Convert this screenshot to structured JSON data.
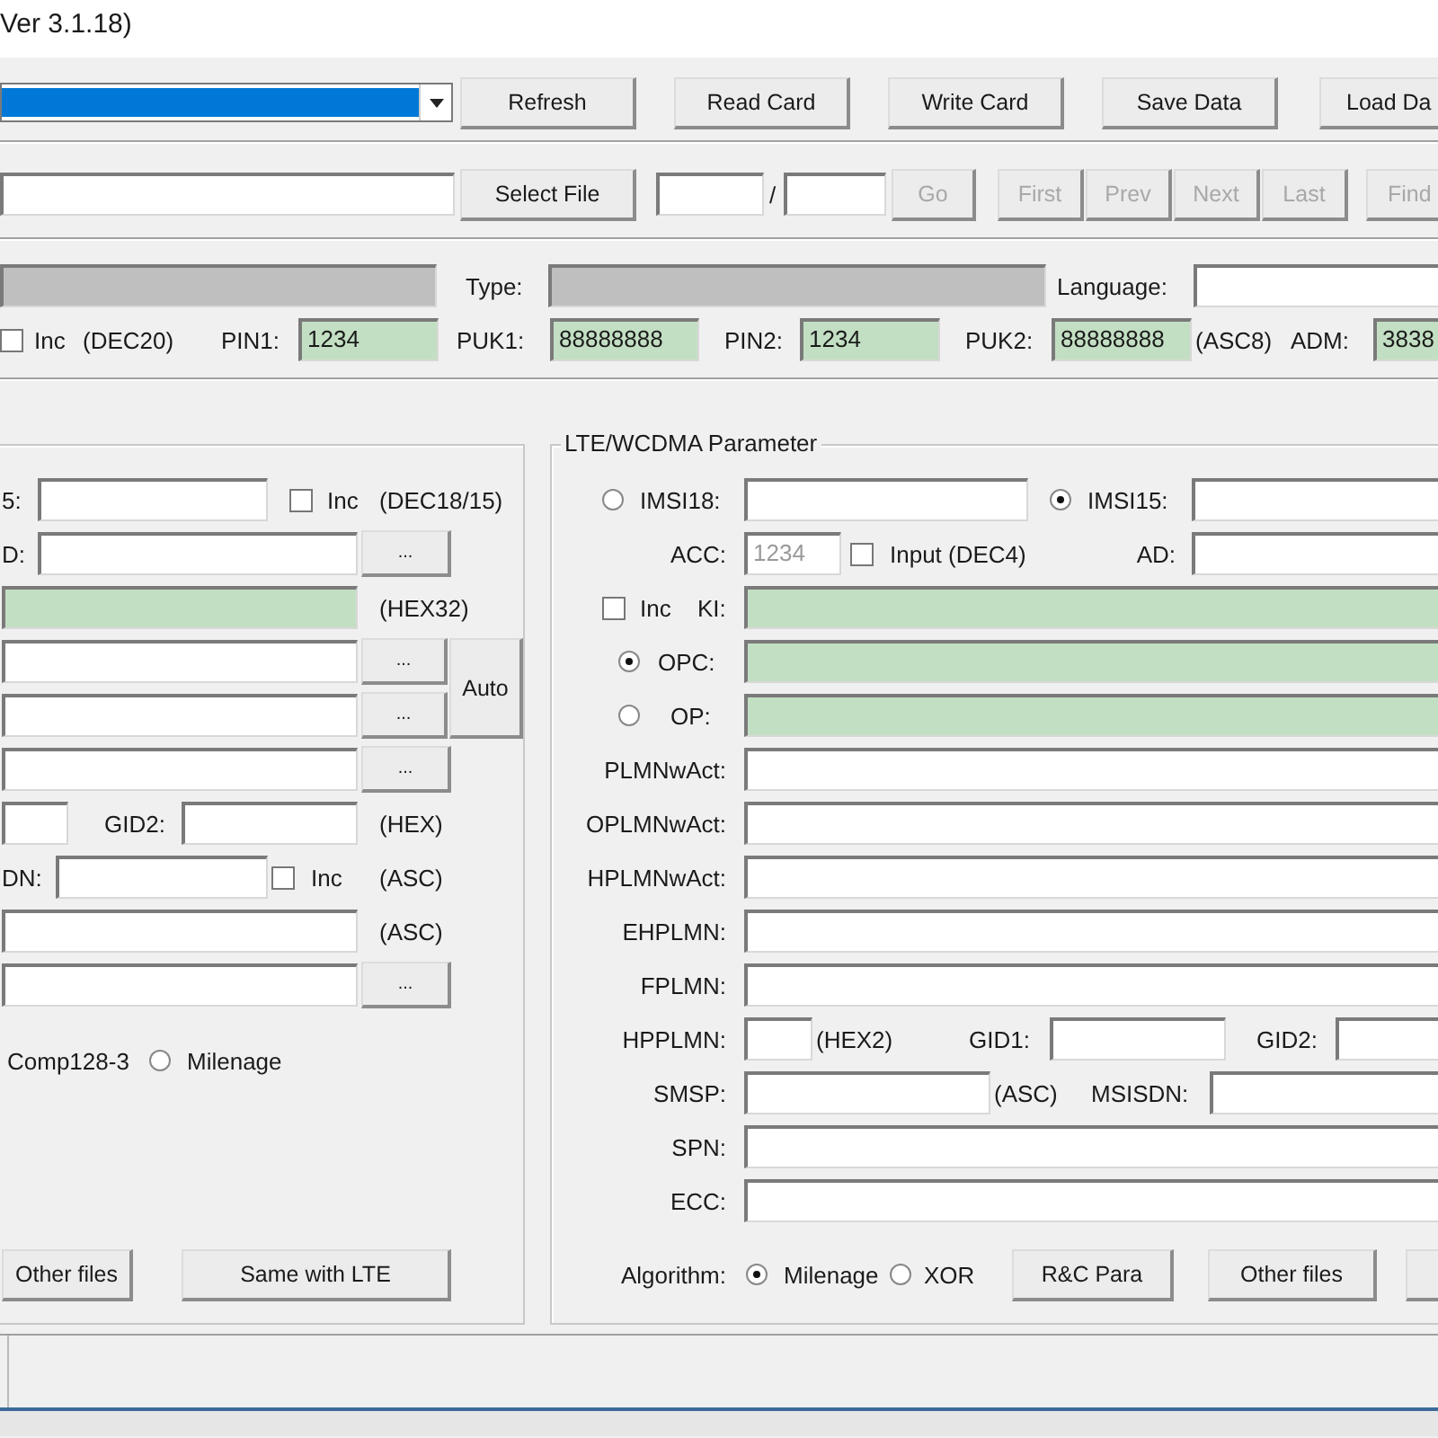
{
  "window": {
    "title": "Ver 3.1.18)"
  },
  "toolbar": {
    "buttons": [
      "Refresh",
      "Read Card",
      "Write Card",
      "Save Data",
      "Load Da"
    ]
  },
  "file_bar": {
    "select_button": "Select File",
    "separator": "/",
    "go": {
      "label": "Go",
      "disabled": true
    },
    "navigation": [
      {
        "label": "First",
        "disabled": true
      },
      {
        "label": "Prev",
        "disabled": true
      },
      {
        "label": "Next",
        "disabled": true
      },
      {
        "label": "Last",
        "disabled": true
      },
      {
        "label": "Find",
        "disabled": true
      }
    ]
  },
  "card_info": {
    "type_label": "Type:",
    "language_label": "Language:",
    "inc": {
      "label": "Inc",
      "checked": false
    },
    "format": "(DEC20)",
    "codes": [
      {
        "label": "PIN1:",
        "value": "1234"
      },
      {
        "label": "PUK1:",
        "value": "88888888"
      },
      {
        "label": "PIN2:",
        "value": "1234"
      },
      {
        "label": "PUK2:",
        "value": "88888888"
      },
      {
        "label": "ADM:",
        "value": "3838"
      }
    ],
    "puk2_format": "(ASC8)"
  },
  "gsm": {
    "imsi_label": "5:",
    "inc": {
      "label": "Inc",
      "checked": false
    },
    "imsi_format": "(DEC18/15)",
    "iccid_label": "D:",
    "browse_buttons": [
      "...",
      "...",
      "...",
      "...",
      "..."
    ],
    "ki_format": "(HEX32)",
    "auto_button": "Auto",
    "gid2_label": "GID2:",
    "gid_format": "(HEX)",
    "msisdn_label": "DN:",
    "msisdn_inc": {
      "label": "Inc",
      "checked": false
    },
    "msisdn_format": "(ASC)",
    "spn_format": "(ASC)",
    "comp128_label": "Comp128-3",
    "milenage": {
      "label": "Milenage",
      "selected": false
    },
    "buttons": [
      "Other files",
      "Same with LTE"
    ]
  },
  "lte": {
    "title": "LTE/WCDMA Parameter",
    "imsi18": {
      "label": "IMSI18:",
      "selected": false
    },
    "imsi15": {
      "label": "IMSI15:",
      "selected": true
    },
    "acc": {
      "label": "ACC:",
      "value": "1234",
      "disabled": true
    },
    "acc_input": {
      "label": "Input (DEC4)",
      "checked": false
    },
    "ad_label": "AD:",
    "ki_inc": {
      "label": "Inc",
      "checked": false
    },
    "ki_label": "KI:",
    "opc": {
      "label": "OPC:",
      "selected": true
    },
    "op": {
      "label": "OP:",
      "selected": false
    },
    "plmn_fields": [
      "PLMNwAct:",
      "OPLMNwAct:",
      "HPLMNwAct:",
      "EHPLMN:",
      "FPLMN:"
    ],
    "hpplmn": {
      "label": "HPPLMN:",
      "format": "(HEX2)"
    },
    "gid1_label": "GID1:",
    "gid2_label": "GID2:",
    "smsp": {
      "label": "SMSP:",
      "format": "(ASC)"
    },
    "msisdn_label": "MSISDN:",
    "spn_label": "SPN:",
    "ecc_label": "ECC:",
    "algorithm": {
      "label": "Algorithm:",
      "options": [
        {
          "label": "Milenage",
          "selected": true
        },
        {
          "label": "XOR",
          "selected": false
        }
      ]
    },
    "buttons": [
      "R&C Para",
      "Other files"
    ]
  }
}
